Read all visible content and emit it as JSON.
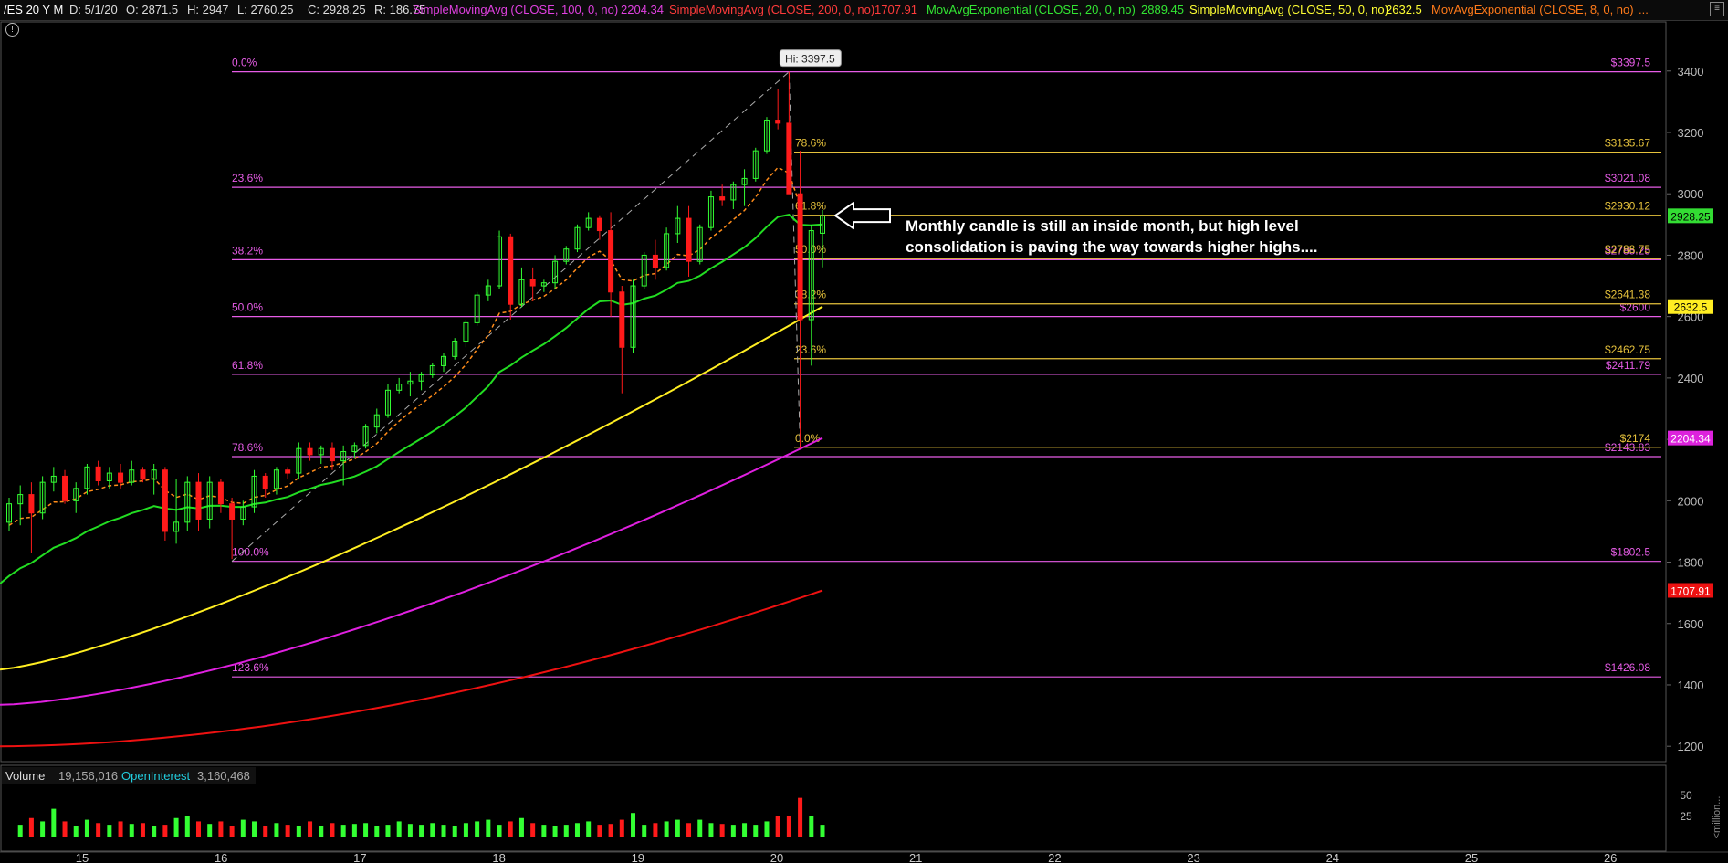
{
  "header": {
    "symbol": "/ES 20 Y M",
    "ohlc": [
      {
        "id": "d",
        "text": "D: 5/1/20",
        "color": "#dddddd"
      },
      {
        "id": "o",
        "text": "O: 2871.5",
        "color": "#dddddd"
      },
      {
        "id": "h",
        "text": "H: 2947",
        "color": "#dddddd"
      },
      {
        "id": "l",
        "text": "L: 2760.25",
        "color": "#dddddd"
      },
      {
        "id": "c",
        "text": "C: 2928.25",
        "color": "#dddddd"
      },
      {
        "id": "r",
        "text": "R: 186.75",
        "color": "#dddddd"
      }
    ],
    "studies": [
      {
        "label": "SimpleMovingAvg (CLOSE, 100, 0, no)",
        "value": "2204.34",
        "color": "#e040e0"
      },
      {
        "label": "SimpleMovingAvg (CLOSE, 200, 0, no)",
        "value": "1707.91",
        "color": "#ff3b3b"
      },
      {
        "label": "MovAvgExponential (CLOSE, 20, 0, no)",
        "value": "2889.45",
        "color": "#33e633"
      },
      {
        "label": "SimpleMovingAvg (CLOSE, 50, 0, no)",
        "value": "2632.5",
        "color": "#ffff33"
      },
      {
        "label": "MovAvgExponential (CLOSE, 8, 0, no)",
        "value": "...",
        "color": "#ff7a1a"
      }
    ],
    "info_icon": "info-icon",
    "corner_icon": "menu-icon"
  },
  "colors": {
    "up": "#33ff33",
    "down": "#ff1a1a",
    "fib_magenta": "#e65ce6",
    "fib_gold": "#e6c23c",
    "sma100": "#e020e0",
    "sma200": "#ee1111",
    "ema20": "#22dd22",
    "sma50": "#ffee22",
    "ema8": "#ff8c1a"
  },
  "chart_data": {
    "type": "candlestick",
    "timeframe": "monthly",
    "ylim": [
      1150,
      3560
    ],
    "y_ticks": [
      "1200",
      "1400",
      "1600",
      "1800",
      "2000",
      "2200",
      "2400",
      "2600",
      "2800",
      "3000",
      "3200",
      "3400"
    ],
    "x_ticks": [
      "15",
      "16",
      "17",
      "18",
      "19",
      "20",
      "21",
      "22",
      "23",
      "24",
      "25",
      "26"
    ],
    "high_label": "Hi: 3397.5",
    "annotation": "Monthly candle is still an inside month, but high level consolidation is paving the way towards higher highs....",
    "price_tags": [
      {
        "value": 2928.25,
        "text": "2928.25",
        "bg": "#33dd33",
        "fg": "#000000"
      },
      {
        "value": 2632.5,
        "text": "2632.5",
        "bg": "#ffee22",
        "fg": "#000000"
      },
      {
        "value": 2204.34,
        "text": "2204.34",
        "bg": "#dd22dd",
        "fg": "#ffffff"
      },
      {
        "value": 1707.91,
        "text": "1707.91",
        "bg": "#ee1111",
        "fg": "#ffffff"
      }
    ],
    "fib_long": [
      {
        "pct": "0.0%",
        "value": 3397.5,
        "text": "$3397.5"
      },
      {
        "pct": "23.6%",
        "value": 3021.08,
        "text": "$3021.08"
      },
      {
        "pct": "38.2%",
        "value": 2785.25,
        "text": "$2785.25"
      },
      {
        "pct": "50.0%",
        "value": 2600,
        "text": "$2600"
      },
      {
        "pct": "61.8%",
        "value": 2411.79,
        "text": "$2411.79"
      },
      {
        "pct": "78.6%",
        "value": 2143.83,
        "text": "$2143.83"
      },
      {
        "pct": "100.0%",
        "value": 1802.5,
        "text": "$1802.5"
      },
      {
        "pct": "123.6%",
        "value": 1426.08,
        "text": "$1426.08"
      }
    ],
    "fib_short": [
      {
        "pct": "78.6%",
        "value": 3135.67,
        "text": "$3135.67"
      },
      {
        "pct": "61.8%",
        "value": 2930.12,
        "text": "$2930.12"
      },
      {
        "pct": "50.0%",
        "value": 2788.75,
        "text": "$2788.75"
      },
      {
        "pct": "38.2%",
        "value": 2641.38,
        "text": "$2641.38"
      },
      {
        "pct": "23.6%",
        "value": 2462.75,
        "text": "$2462.75"
      },
      {
        "pct": "0.0%",
        "value": 2174,
        "text": "$2174"
      }
    ],
    "candles": [
      {
        "o": 1930,
        "h": 2010,
        "l": 1900,
        "c": 1990
      },
      {
        "o": 1990,
        "h": 2050,
        "l": 1920,
        "c": 2020
      },
      {
        "o": 2020,
        "h": 2060,
        "l": 1830,
        "c": 1960
      },
      {
        "o": 1960,
        "h": 2080,
        "l": 1940,
        "c": 2060
      },
      {
        "o": 2060,
        "h": 2110,
        "l": 2030,
        "c": 2080
      },
      {
        "o": 2080,
        "h": 2100,
        "l": 1990,
        "c": 2000
      },
      {
        "o": 2000,
        "h": 2060,
        "l": 1960,
        "c": 2040
      },
      {
        "o": 2040,
        "h": 2120,
        "l": 2020,
        "c": 2110
      },
      {
        "o": 2110,
        "h": 2130,
        "l": 2050,
        "c": 2065
      },
      {
        "o": 2065,
        "h": 2110,
        "l": 2040,
        "c": 2090
      },
      {
        "o": 2090,
        "h": 2120,
        "l": 2040,
        "c": 2060
      },
      {
        "o": 2060,
        "h": 2130,
        "l": 2050,
        "c": 2100
      },
      {
        "o": 2100,
        "h": 2110,
        "l": 2060,
        "c": 2070
      },
      {
        "o": 2070,
        "h": 2120,
        "l": 2020,
        "c": 2100
      },
      {
        "o": 2100,
        "h": 2110,
        "l": 1870,
        "c": 1900
      },
      {
        "o": 1900,
        "h": 2070,
        "l": 1860,
        "c": 1930
      },
      {
        "o": 1930,
        "h": 2080,
        "l": 1900,
        "c": 2060
      },
      {
        "o": 2060,
        "h": 2090,
        "l": 1900,
        "c": 1940
      },
      {
        "o": 1940,
        "h": 2080,
        "l": 1910,
        "c": 2060
      },
      {
        "o": 2060,
        "h": 2070,
        "l": 1960,
        "c": 1990
      },
      {
        "o": 1990,
        "h": 2010,
        "l": 1810,
        "c": 1940
      },
      {
        "o": 1940,
        "h": 2000,
        "l": 1920,
        "c": 1980
      },
      {
        "o": 1980,
        "h": 2100,
        "l": 1960,
        "c": 2080
      },
      {
        "o": 2080,
        "h": 2090,
        "l": 2010,
        "c": 2040
      },
      {
        "o": 2040,
        "h": 2110,
        "l": 2020,
        "c": 2100
      },
      {
        "o": 2100,
        "h": 2110,
        "l": 2070,
        "c": 2090
      },
      {
        "o": 2090,
        "h": 2190,
        "l": 2070,
        "c": 2170
      },
      {
        "o": 2170,
        "h": 2190,
        "l": 2130,
        "c": 2150
      },
      {
        "o": 2150,
        "h": 2180,
        "l": 2120,
        "c": 2170
      },
      {
        "o": 2170,
        "h": 2190,
        "l": 2100,
        "c": 2130
      },
      {
        "o": 2130,
        "h": 2180,
        "l": 2050,
        "c": 2160
      },
      {
        "o": 2160,
        "h": 2190,
        "l": 2140,
        "c": 2180
      },
      {
        "o": 2180,
        "h": 2250,
        "l": 2170,
        "c": 2240
      },
      {
        "o": 2240,
        "h": 2300,
        "l": 2220,
        "c": 2280
      },
      {
        "o": 2280,
        "h": 2380,
        "l": 2270,
        "c": 2360
      },
      {
        "o": 2360,
        "h": 2400,
        "l": 2350,
        "c": 2380
      },
      {
        "o": 2380,
        "h": 2420,
        "l": 2340,
        "c": 2390
      },
      {
        "o": 2390,
        "h": 2420,
        "l": 2360,
        "c": 2410
      },
      {
        "o": 2410,
        "h": 2450,
        "l": 2400,
        "c": 2440
      },
      {
        "o": 2440,
        "h": 2480,
        "l": 2420,
        "c": 2470
      },
      {
        "o": 2470,
        "h": 2530,
        "l": 2460,
        "c": 2520
      },
      {
        "o": 2520,
        "h": 2590,
        "l": 2500,
        "c": 2580
      },
      {
        "o": 2580,
        "h": 2680,
        "l": 2570,
        "c": 2670
      },
      {
        "o": 2670,
        "h": 2720,
        "l": 2650,
        "c": 2700
      },
      {
        "o": 2700,
        "h": 2880,
        "l": 2690,
        "c": 2860
      },
      {
        "o": 2860,
        "h": 2870,
        "l": 2590,
        "c": 2640
      },
      {
        "o": 2640,
        "h": 2760,
        "l": 2630,
        "c": 2720
      },
      {
        "o": 2720,
        "h": 2760,
        "l": 2650,
        "c": 2700
      },
      {
        "o": 2700,
        "h": 2720,
        "l": 2680,
        "c": 2710
      },
      {
        "o": 2710,
        "h": 2800,
        "l": 2690,
        "c": 2780
      },
      {
        "o": 2780,
        "h": 2830,
        "l": 2770,
        "c": 2820
      },
      {
        "o": 2820,
        "h": 2900,
        "l": 2810,
        "c": 2890
      },
      {
        "o": 2890,
        "h": 2940,
        "l": 2880,
        "c": 2920
      },
      {
        "o": 2920,
        "h": 2930,
        "l": 2850,
        "c": 2880
      },
      {
        "o": 2880,
        "h": 2940,
        "l": 2600,
        "c": 2680
      },
      {
        "o": 2680,
        "h": 2700,
        "l": 2350,
        "c": 2500
      },
      {
        "o": 2500,
        "h": 2720,
        "l": 2480,
        "c": 2700
      },
      {
        "o": 2700,
        "h": 2810,
        "l": 2690,
        "c": 2800
      },
      {
        "o": 2800,
        "h": 2850,
        "l": 2720,
        "c": 2760
      },
      {
        "o": 2760,
        "h": 2890,
        "l": 2750,
        "c": 2870
      },
      {
        "o": 2870,
        "h": 2960,
        "l": 2840,
        "c": 2920
      },
      {
        "o": 2920,
        "h": 2960,
        "l": 2730,
        "c": 2780
      },
      {
        "o": 2780,
        "h": 2900,
        "l": 2770,
        "c": 2890
      },
      {
        "o": 2890,
        "h": 3010,
        "l": 2880,
        "c": 2990
      },
      {
        "o": 2990,
        "h": 3030,
        "l": 2960,
        "c": 2980
      },
      {
        "o": 2980,
        "h": 3040,
        "l": 2950,
        "c": 3030
      },
      {
        "o": 3030,
        "h": 3080,
        "l": 2960,
        "c": 3050
      },
      {
        "o": 3050,
        "h": 3150,
        "l": 3040,
        "c": 3140
      },
      {
        "o": 3140,
        "h": 3250,
        "l": 3130,
        "c": 3240
      },
      {
        "o": 3240,
        "h": 3340,
        "l": 3210,
        "c": 3230
      },
      {
        "o": 3230,
        "h": 3397.5,
        "l": 3150,
        "c": 3000
      },
      {
        "o": 3000,
        "h": 3140,
        "l": 2170,
        "c": 2590
      },
      {
        "o": 2590,
        "h": 2900,
        "l": 2440,
        "c": 2880
      },
      {
        "o": 2871.5,
        "h": 2947,
        "l": 2760.25,
        "c": 2928.25
      }
    ],
    "sma200": {
      "first": 1200,
      "last": 1707.91
    },
    "sma100": {
      "first": 1335,
      "last": 2204.34
    },
    "sma50": {
      "first": 1450,
      "last": 2632.5
    },
    "ema20": {
      "first": 1730,
      "last": 2889.45
    },
    "volume_panel": {
      "label": "Volume",
      "value": "19,156,016",
      "oi_label": "OpenInterest",
      "oi_value": "3,160,468",
      "y_ticks": [
        "50",
        "25"
      ],
      "axis_label": "<million...",
      "ylim": [
        0,
        63
      ],
      "volumes": [
        14,
        22,
        18,
        33,
        18,
        12,
        20,
        16,
        14,
        18,
        15,
        16,
        13,
        14,
        22,
        24,
        18,
        15,
        18,
        12,
        20,
        18,
        12,
        16,
        14,
        12,
        18,
        12,
        16,
        14,
        15,
        16,
        12,
        14,
        18,
        15,
        14,
        16,
        14,
        13,
        16,
        18,
        20,
        14,
        18,
        22,
        16,
        14,
        12,
        14,
        16,
        18,
        14,
        15,
        20,
        28,
        14,
        16,
        18,
        20,
        16,
        20,
        16,
        15,
        14,
        16,
        14,
        18,
        24,
        25,
        46,
        24,
        14
      ]
    }
  }
}
